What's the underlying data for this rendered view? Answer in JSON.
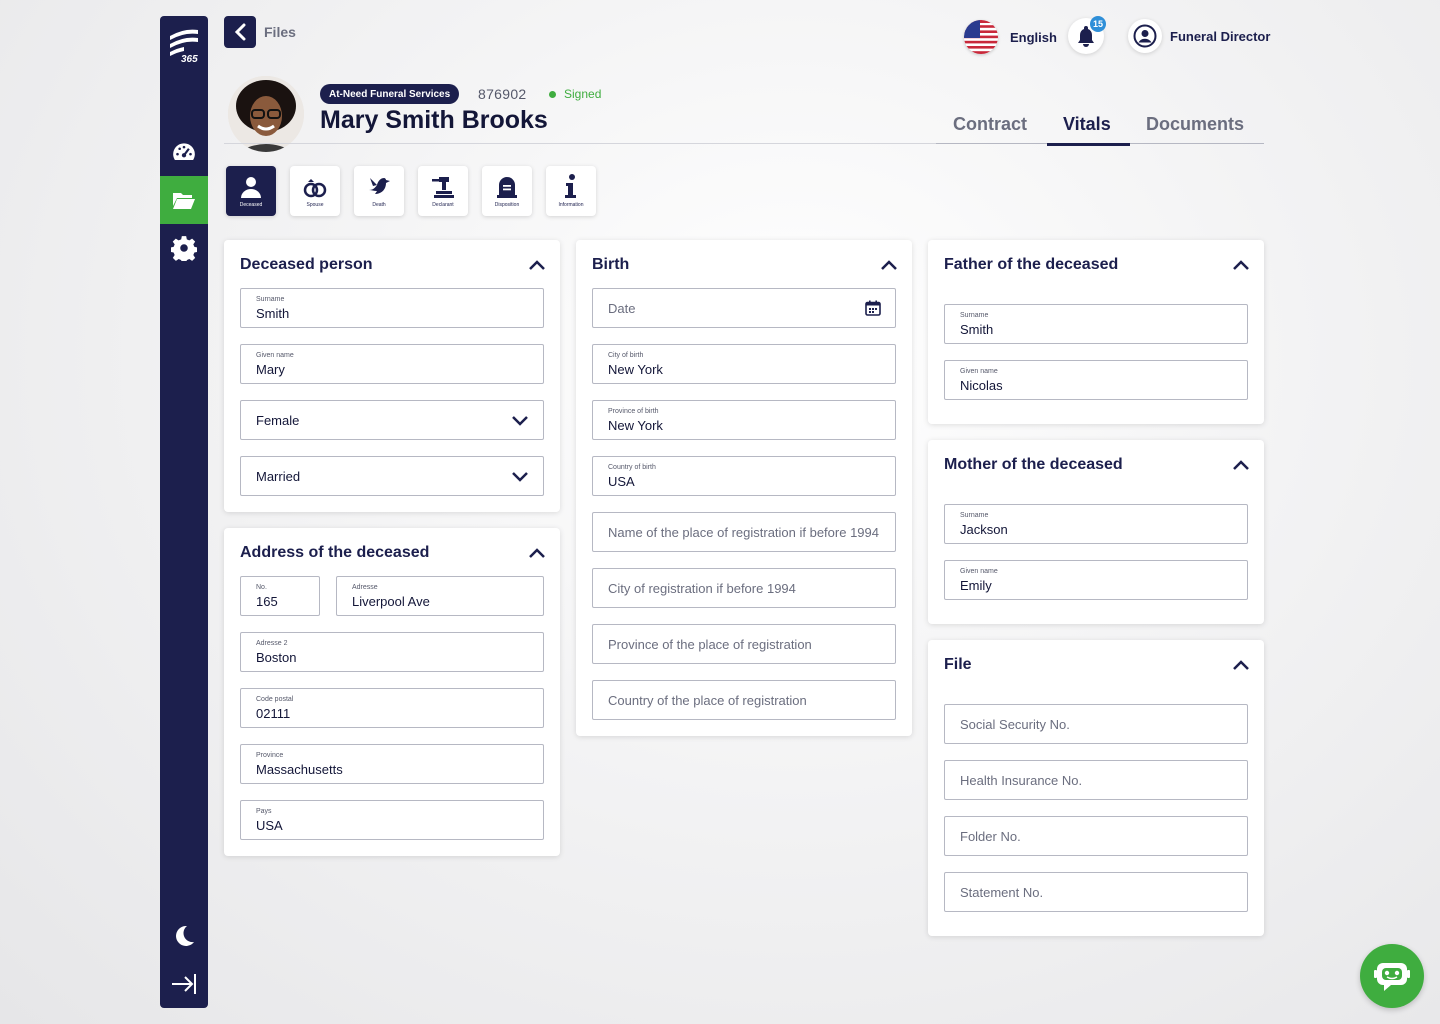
{
  "sidebar": {
    "logo_text": "365",
    "items": [
      {
        "name": "dashboard",
        "icon": "speedometer-icon"
      },
      {
        "name": "files",
        "icon": "folder-icon",
        "active": true
      },
      {
        "name": "settings",
        "icon": "gear-icon"
      }
    ],
    "bottom": [
      {
        "name": "dark-mode",
        "icon": "moon-icon"
      },
      {
        "name": "logout",
        "icon": "logout-arrow-icon"
      }
    ]
  },
  "topbar": {
    "back_icon": "chevron-left-icon",
    "breadcrumb": "Files",
    "language": "English",
    "notifications_count": "15",
    "user_role": "Funeral Director"
  },
  "header": {
    "service": "At-Need Funeral Services",
    "file_number": "876902",
    "status": "Signed",
    "name": "Mary Smith Brooks"
  },
  "tabs": [
    "Contract",
    "Vitals",
    "Documents"
  ],
  "active_tab": "Vitals",
  "subtabs": [
    {
      "label": "Deceased",
      "icon": "person-icon",
      "active": true
    },
    {
      "label": "Spouse",
      "icon": "rings-icon"
    },
    {
      "label": "Death",
      "icon": "dove-icon"
    },
    {
      "label": "Declarant",
      "icon": "gavel-icon"
    },
    {
      "label": "Disposition",
      "icon": "tombstone-icon"
    },
    {
      "label": "Information",
      "icon": "info-icon"
    }
  ],
  "deceased": {
    "title": "Deceased person",
    "surname_label": "Surname",
    "surname": "Smith",
    "given_label": "Given name",
    "given": "Mary",
    "sex": "Female",
    "marital": "Married"
  },
  "address": {
    "title": "Address of the deceased",
    "no_label": "No.",
    "no": "165",
    "street_label": "Adresse",
    "street": "Liverpool Ave",
    "address2_label": "Adresse 2",
    "address2": "Boston",
    "postal_label": "Code postal",
    "postal": "02111",
    "province_label": "Province",
    "province": "Massachusetts",
    "country_label": "Pays",
    "country": "USA"
  },
  "birth": {
    "title": "Birth",
    "date_placeholder": "Date",
    "city_label": "City of birth",
    "city": "New York",
    "province_label": "Province of birth",
    "province": "New York",
    "country_label": "Country of birth",
    "country": "USA",
    "reg_place_placeholder": "Name of the place of registration if before 1994",
    "reg_city_placeholder": "City of registration if before 1994",
    "reg_province_placeholder": "Province of the place of registration",
    "reg_country_placeholder": "Country of the place of registration"
  },
  "father": {
    "title": "Father of the deceased",
    "surname_label": "Surname",
    "surname": "Smith",
    "given_label": "Given name",
    "given": "Nicolas"
  },
  "mother": {
    "title": "Mother of the deceased",
    "surname_label": "Surname",
    "surname": "Jackson",
    "given_label": "Given name",
    "given": "Emily"
  },
  "file": {
    "title": "File",
    "ssn_placeholder": "Social Security No.",
    "health_placeholder": "Health Insurance No.",
    "folder_placeholder": "Folder No.",
    "statement_placeholder": "Statement No."
  },
  "colors": {
    "navy": "#1c1f4d",
    "green": "#3fad3f",
    "badge_blue": "#2f8fd8"
  }
}
